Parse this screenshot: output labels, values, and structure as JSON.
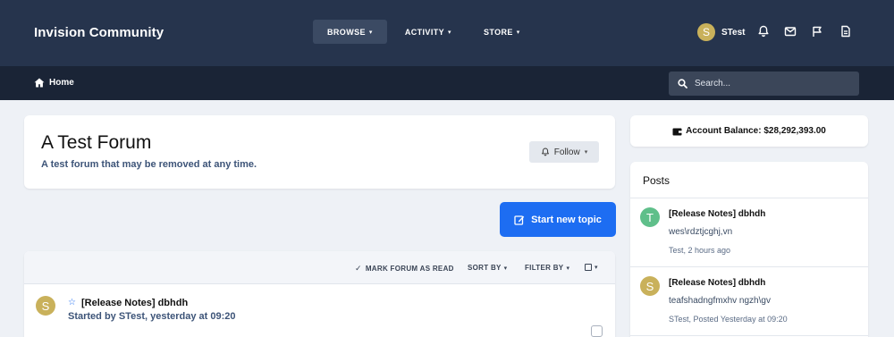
{
  "header": {
    "brand": "Invision Community",
    "nav": [
      {
        "label": "BROWSE",
        "active": true
      },
      {
        "label": "ACTIVITY",
        "active": false
      },
      {
        "label": "STORE",
        "active": false
      }
    ],
    "user": {
      "initial": "S",
      "name": "STest",
      "avatar_color": "#c9b15b"
    },
    "icons": [
      "bell-icon",
      "envelope-icon",
      "flag-icon",
      "document-icon"
    ]
  },
  "subbar": {
    "home_label": "Home",
    "search_placeholder": "Search..."
  },
  "forum": {
    "title": "A Test Forum",
    "description": "A test forum that may be removed at any time.",
    "follow_label": "Follow"
  },
  "actions": {
    "start_topic_label": "Start new topic"
  },
  "topics_toolbar": {
    "mark_read": "MARK FORUM AS READ",
    "sort_by": "SORT BY",
    "filter_by": "FILTER BY"
  },
  "topics": [
    {
      "initial": "S",
      "title": "[Release Notes] dbhdh",
      "meta": "Started by STest, yesterday at 09:20"
    }
  ],
  "sidebar": {
    "balance": "Account Balance: $28,292,393.00",
    "posts_heading": "Posts",
    "posts": [
      {
        "initial": "T",
        "avatar_color": "#5fbf8a",
        "title": "[Release Notes] dbhdh",
        "snippet": "wes\\rdztjcghj,vn",
        "meta": "Test, 2 hours ago"
      },
      {
        "initial": "S",
        "avatar_color": "#c9b15b",
        "title": "[Release Notes] dbhdh",
        "snippet": "teafshadngfmxhv ngzh\\gv",
        "meta": "STest, Posted Yesterday at 09:20"
      }
    ]
  },
  "colors": {
    "header_bg": "#26344d",
    "subbar_bg": "#1a2436",
    "accent": "#1d6df2"
  }
}
